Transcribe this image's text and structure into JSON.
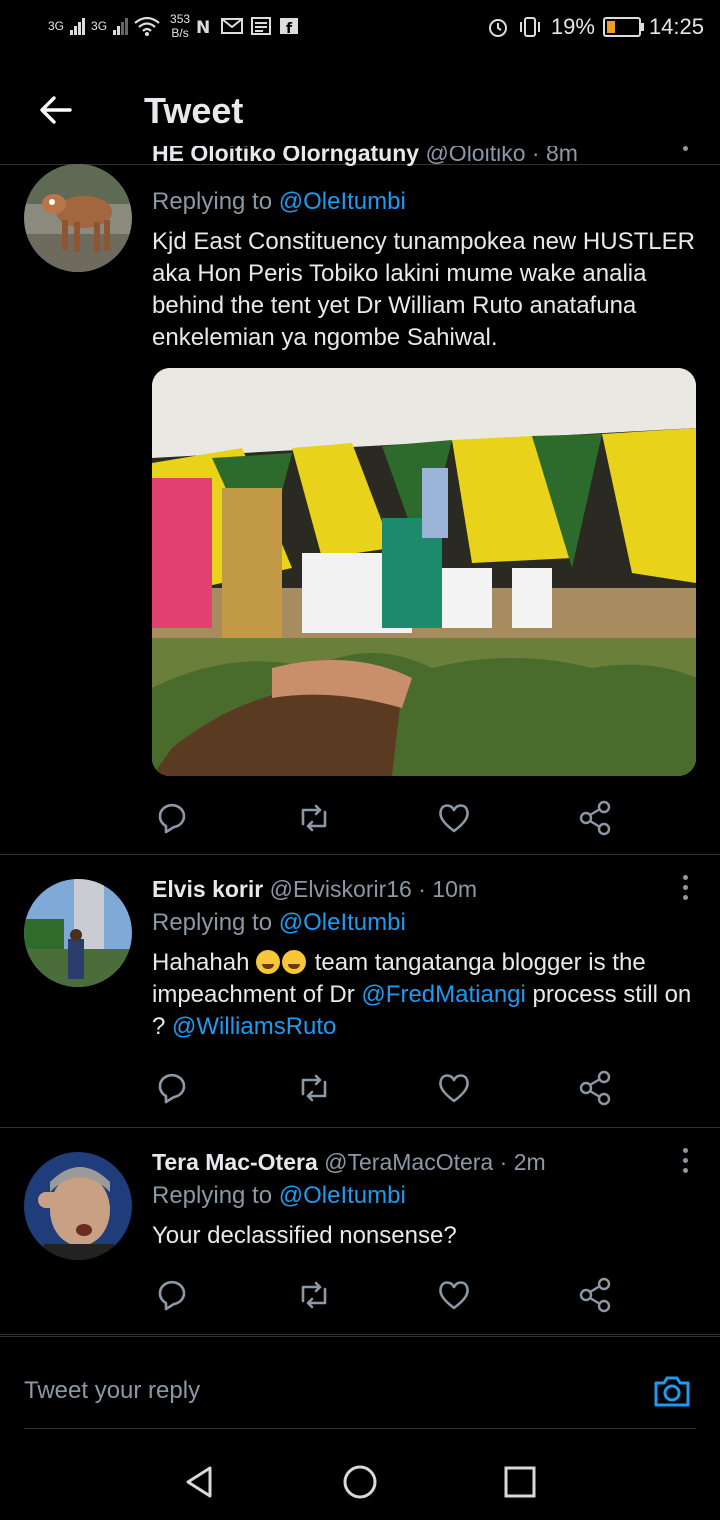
{
  "status_bar": {
    "sim1": "3G",
    "sim2": "3G",
    "speed_value": "353",
    "speed_unit": "B/s",
    "battery_percent": "19%",
    "time": "14:25",
    "battery_level": 0.19,
    "battery_color": "#f0a020"
  },
  "app_bar": {
    "title": "Tweet",
    "back_icon": "back-arrow-icon"
  },
  "tweets": [
    {
      "name": "HE Oloitiko Olorngatuny",
      "handle": "@Oloitiko",
      "time": "8m",
      "replying_prefix": "Replying to",
      "replying_to": "@OleItumbi",
      "text": "Kjd East Constituency tunampokea new HUSTLER aka Hon Peris Tobiko lakini mume wake analia behind the tent yet Dr William Ruto anatafuna enkelemian ya ngombe Sahiwal."
    },
    {
      "name": "Elvis korir",
      "handle": "@Elviskorir16",
      "time": "10m",
      "replying_prefix": "Replying to",
      "replying_to": "@OleItumbi",
      "text_part1": "Hahahah ",
      "text_part2": " team tangatanga blogger is the impeachment of Dr ",
      "mention1": "@FredMatiangi",
      "text_part3": " process still on ? ",
      "mention2": "@WilliamsRuto"
    },
    {
      "name": "Tera Mac-Otera",
      "handle": "@TeraMacOtera",
      "time": "2m",
      "replying_prefix": "Replying to",
      "replying_to": "@OleItumbi",
      "text": "Your declassified nonsense?"
    }
  ],
  "composer": {
    "placeholder": "Tweet your reply",
    "camera_icon": "camera-icon"
  },
  "colors": {
    "accent": "#1d9bf0",
    "background": "#000000",
    "secondary_text": "#8b98a5"
  }
}
